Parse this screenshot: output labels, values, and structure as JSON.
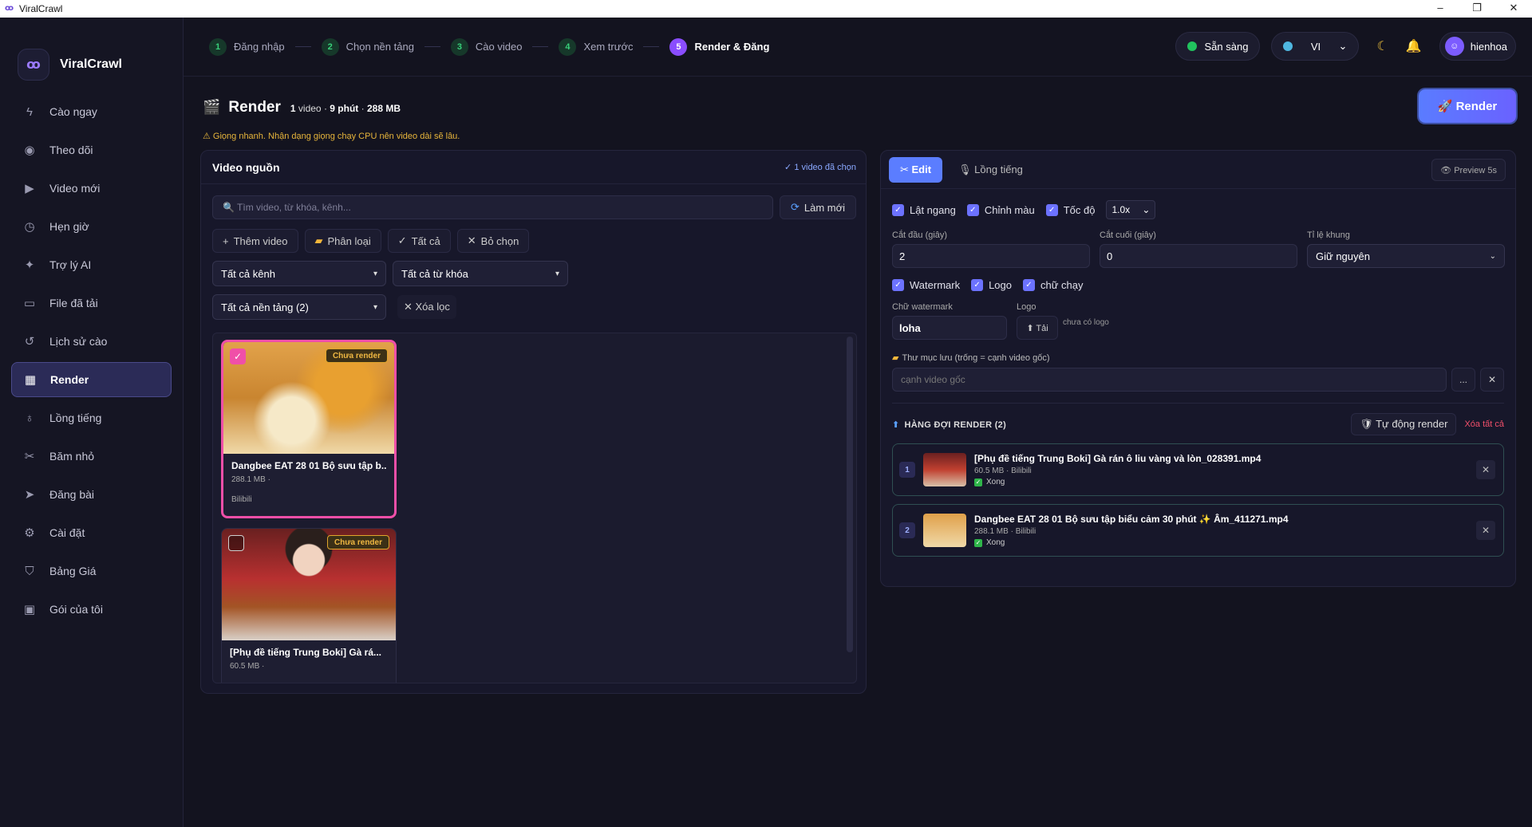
{
  "window": {
    "title": "ViralCrawl",
    "controls": [
      "–",
      "❐",
      "✕"
    ]
  },
  "brand": {
    "logo": "ꝏ",
    "name": "ViralCrawl"
  },
  "sidebar": {
    "items": [
      {
        "label": "Cào ngay",
        "icon": "ϟ"
      },
      {
        "label": "Theo dõi",
        "icon": "◉"
      },
      {
        "label": "Video mới",
        "icon": "▶"
      },
      {
        "label": "Hẹn giờ",
        "icon": "◷"
      },
      {
        "label": "Trợ lý AI",
        "icon": "✦"
      },
      {
        "label": "File đã tải",
        "icon": "▭"
      },
      {
        "label": "Lịch sử cào",
        "icon": "↺"
      },
      {
        "label": "Render",
        "icon": "▦"
      },
      {
        "label": "Lồng tiếng",
        "icon": "♁"
      },
      {
        "label": "Băm nhỏ",
        "icon": "✂"
      },
      {
        "label": "Đăng bài",
        "icon": "➤"
      },
      {
        "label": "Cài đặt",
        "icon": "⚙"
      },
      {
        "label": "Bảng Giá",
        "icon": "⛉"
      },
      {
        "label": "Gói của tôi",
        "icon": "▣"
      }
    ]
  },
  "steps": [
    {
      "num": "1",
      "label": "Đăng nhập"
    },
    {
      "num": "2",
      "label": "Chọn nền tảng"
    },
    {
      "num": "3",
      "label": "Cào video"
    },
    {
      "num": "4",
      "label": "Xem trước"
    },
    {
      "num": "5",
      "label": "Render & Đăng"
    }
  ],
  "topbar": {
    "status": "Sẵn sàng",
    "lang": "VI",
    "lang_chevron": "⌄",
    "moon": "☾",
    "bell": "🔔",
    "user_icon": "☺",
    "user": "hienhoa"
  },
  "header": {
    "icon": "🎬",
    "title": "Render",
    "meta_count": "1",
    "meta_count_unit": "video",
    "meta_sep1": "·",
    "meta_duration": "9 phút",
    "meta_sep2": "·",
    "meta_size": "288 MB",
    "warning": "⚠ Giọng nhanh. Nhận dạng giọng chạy CPU nên video dài sẽ lâu.",
    "render_button": "🚀 Render"
  },
  "source": {
    "title": "Video nguồn",
    "chosen": "✓ 1 video đã chọn",
    "search_placeholder": "🔍 Tìm video, từ khóa, kênh...",
    "refresh_icon": "⟳",
    "refresh": "Làm mới",
    "buttons": [
      {
        "icon": "+",
        "label": "Thêm video"
      },
      {
        "icon": "▰",
        "label": "Phân loại"
      },
      {
        "icon": "✓",
        "label": "Tất cả"
      },
      {
        "icon": "✕",
        "label": "Bỏ chọn"
      }
    ],
    "filter_channel": "Tất cả kênh",
    "filter_keyword": "Tất cả từ khóa",
    "filter_platform": "Tất cả nền tảng (2)",
    "clear_filter": "✕ Xóa lọc",
    "select_chevron": "▾",
    "cards": [
      {
        "title": "Dangbee EAT 28 01 Bộ sưu tập b...",
        "size": "288.1 MB ·",
        "source": "Bilibili",
        "badge": "Chưa render",
        "checked": true
      },
      {
        "title": "[Phụ đề tiếng Trung Boki] Gà rá...",
        "size": "60.5 MB ·",
        "source": "",
        "badge": "Chưa render",
        "checked": false
      }
    ]
  },
  "edit": {
    "tab_edit": "✂ Edit",
    "tab_dub": "🎙 Lồng tiếng",
    "preview": "👁 Preview 5s",
    "opt_flip": "Lật ngang",
    "opt_color": "Chỉnh màu",
    "opt_speed": "Tốc độ",
    "speed_value": "1.0x",
    "chevron": "⌄",
    "label_start": "Cắt đầu (giây)",
    "value_start": "2",
    "label_end": "Cắt cuối (giây)",
    "value_end": "0",
    "label_ratio": "Tỉ lệ khung",
    "value_ratio": "Giữ nguyên",
    "opt_watermark": "Watermark",
    "opt_logo": "Logo",
    "opt_marquee": "chữ chạy",
    "label_wm_text": "Chữ watermark",
    "value_wm_text": "loha",
    "label_logo": "Logo",
    "upload": "⬆ Tải",
    "no_logo": "chưa có logo",
    "folder_icon": "▰",
    "folder_label": "Thư mục lưu (trống = cạnh video gốc)",
    "folder_placeholder": "cạnh video gốc",
    "browse": "...",
    "clear_folder": "✕",
    "check": "✓"
  },
  "queue": {
    "icon": "⬆",
    "title": "HÀNG ĐỢI RENDER (2)",
    "auto": "🛡 Tự động render",
    "clear_all": "Xóa tất cả",
    "items": [
      {
        "num": "1",
        "name": "[Phụ đề tiếng Trung Boki] Gà rán ô liu vàng và lòn_028391.mp4",
        "meta": "60.5 MB · Bilibili",
        "status": "Xong"
      },
      {
        "num": "2",
        "name": "Dangbee EAT 28 01 Bộ sưu tập biểu cảm 30 phút ✨ Âm_411271.mp4",
        "meta": "288.1 MB · Bilibili",
        "status": "Xong"
      }
    ],
    "close": "✕"
  }
}
